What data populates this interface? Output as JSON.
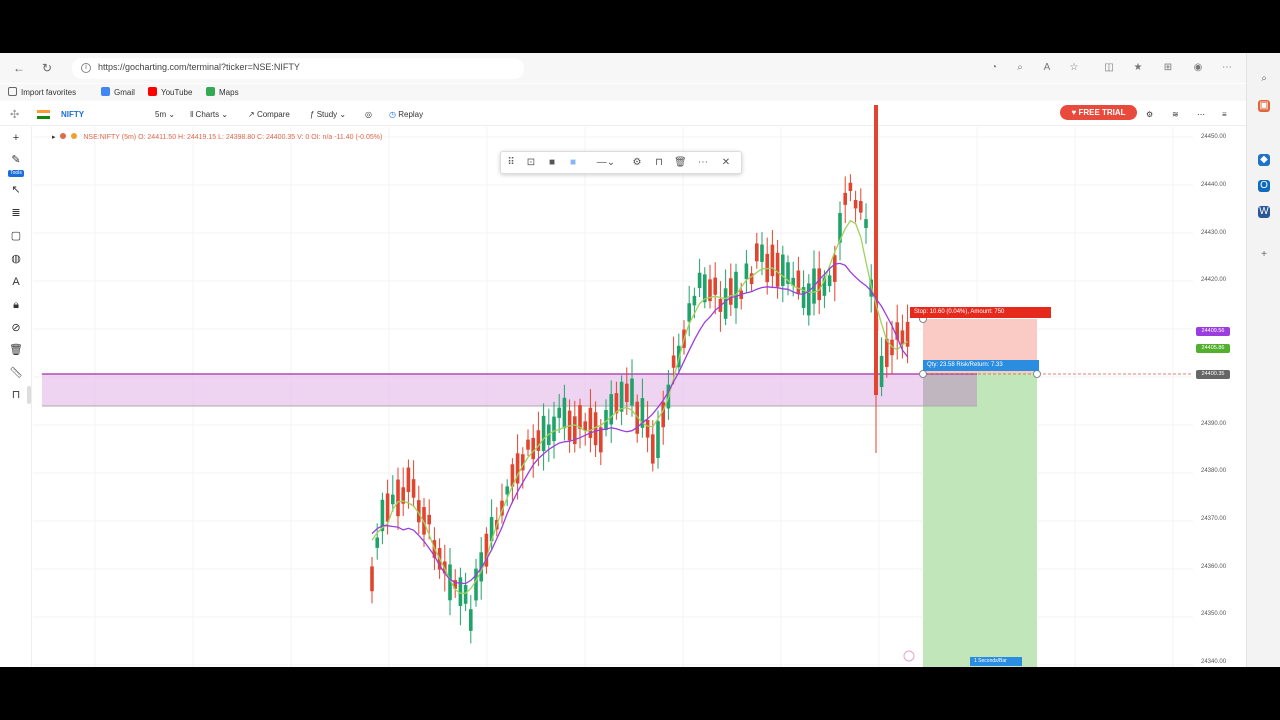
{
  "browser": {
    "url": "https://gocharting.com/terminal?ticker=NSE:NIFTY",
    "bookmarks": [
      {
        "label": "Import favorites",
        "color": "#666"
      },
      {
        "label": "Gmail",
        "color": "#4285f4"
      },
      {
        "label": "YouTube",
        "color": "#ff0000"
      },
      {
        "label": "Maps",
        "color": "#34a853"
      }
    ]
  },
  "toolbar": {
    "symbol": "NIFTY",
    "interval": "5m",
    "charts_label": "Charts",
    "compare_label": "Compare",
    "study_label": "Study",
    "replay_label": "Replay",
    "free_trial_label": "FREE TRIAL"
  },
  "legend": {
    "text": "NSE:NIFTY (5m)  O: 24411.50 H: 24419.15 L: 24398.80 C: 24400.35 V: 0 OI: n/a  -11.40  (-0.05%)"
  },
  "left_tools": {
    "tools_label": "Tools"
  },
  "position_tool": {
    "stop_label": "Stop: 10.60 (0.04%), Amount: 750",
    "qty_label": "Qty: 23.58 Risk/Return: 7.33",
    "timer_label": "1 Seconds/Bar"
  },
  "price_axis": {
    "ticks": [
      "24450.00",
      "24440.00",
      "24430.00",
      "24420.00",
      "24390.00",
      "24380.00",
      "24370.00",
      "24360.00",
      "24350.00",
      "24340.00"
    ],
    "labels": [
      {
        "value": "24409.56",
        "color": "#9b3ddf"
      },
      {
        "value": "24405.86",
        "color": "#53b02f"
      },
      {
        "value": "24400.35",
        "color": "#666666"
      }
    ]
  },
  "colors": {
    "up": "#20a36a",
    "down": "#e0452f",
    "ema_fast": "#9ed25a",
    "ema_slow": "#9b3ddf",
    "zone": "#e8c6ec",
    "target_fill": "#b9e3b3",
    "stop_fill": "#f9c2bb"
  }
}
